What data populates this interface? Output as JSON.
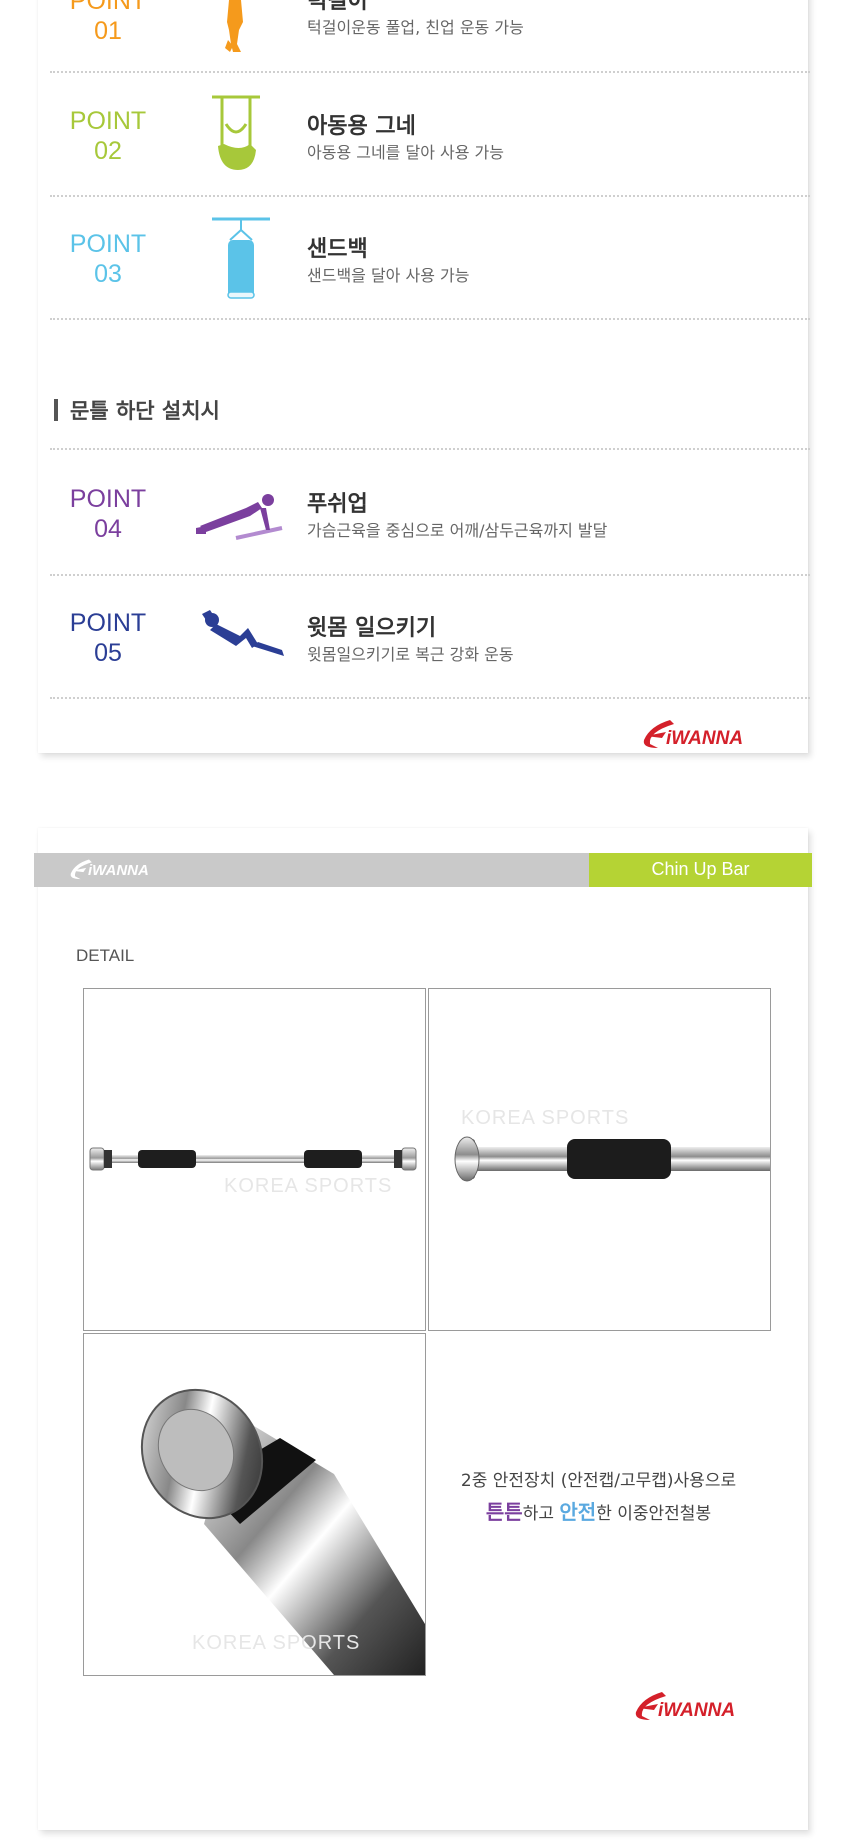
{
  "section1": {
    "items": [
      {
        "point": "POINT",
        "num": "01",
        "title": "턱걸이",
        "desc": "턱걸이운동 풀업, 친업 운동 가능",
        "color": "#f59a1c",
        "icon": "hanging-person-icon"
      },
      {
        "point": "POINT",
        "num": "02",
        "title": "아동용 그네",
        "desc": "아동용 그네를 달아 사용 가능",
        "color": "#a7c83a",
        "icon": "swing-icon"
      },
      {
        "point": "POINT",
        "num": "03",
        "title": "샌드백",
        "desc": "샌드백을 달아 사용 가능",
        "color": "#5bc3e8",
        "icon": "sandbag-icon"
      }
    ],
    "subheading": "문틀 하단 설치시",
    "items2": [
      {
        "point": "POINT",
        "num": "04",
        "title": "푸쉬업",
        "desc": "가슴근육을 중심으로 어깨/삼두근육까지 발달",
        "color": "#7b3f9e",
        "icon": "pushup-icon"
      },
      {
        "point": "POINT",
        "num": "05",
        "title": "윗몸 일으키기",
        "desc": "윗몸일으키기로 복근 강화 운동",
        "color": "#2b3e95",
        "icon": "situp-icon"
      }
    ],
    "logo": "iWANNA"
  },
  "section2": {
    "header_logo": "iWANNA",
    "header_tag": "Chin Up Bar",
    "detail_label": "DETAIL",
    "watermark": "KOREA SPORTS",
    "caption_line1": "2중 안전장치 (안전캡/고무캡)사용으로",
    "caption_word1": "튼튼",
    "caption_mid": "하고 ",
    "caption_word2": "안전",
    "caption_end": "한 이중안전철봉",
    "logo": "iWANNA"
  },
  "colors": {
    "accent_green": "#b5d334",
    "accent_purple": "#7b3f9e",
    "accent_blue": "#5aa9e0",
    "logo_red": "#d4202a",
    "header_gray": "#c9c9c9"
  }
}
